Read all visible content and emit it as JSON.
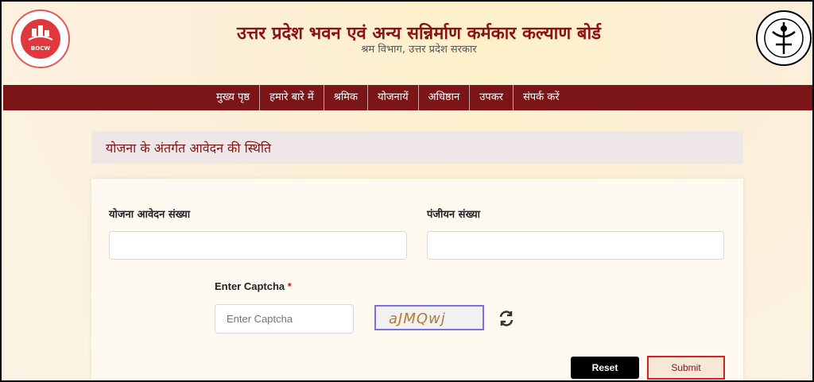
{
  "header": {
    "title": "उत्तर प्रदेश भवन एवं अन्य सन्निर्माण कर्मकार कल्याण बोर्ड",
    "subtitle": "श्रम विभाग, उत्तर प्रदेश सरकार",
    "logo_left_text": "BOCW"
  },
  "nav": {
    "items": [
      "मुख्य पृष्ठ",
      "हमारे बारे में",
      "श्रमिक",
      "योजनायें",
      "अधिष्ठान",
      "उपकर",
      "संपर्क करें"
    ],
    "bg_color": "#7b1518"
  },
  "page": {
    "section_title": "योजना के अंतर्गत आवेदन की स्थिति"
  },
  "form": {
    "application_number_label": "योजना आवेदन संख्या",
    "application_number_value": "",
    "registration_number_label": "पंजीयन संख्या",
    "registration_number_value": "",
    "captcha_label": "Enter Captcha",
    "captcha_required_mark": "*",
    "captcha_placeholder": "Enter Captcha",
    "captcha_text": "aJMQwj",
    "reset_label": "Reset",
    "submit_label": "Submit"
  }
}
